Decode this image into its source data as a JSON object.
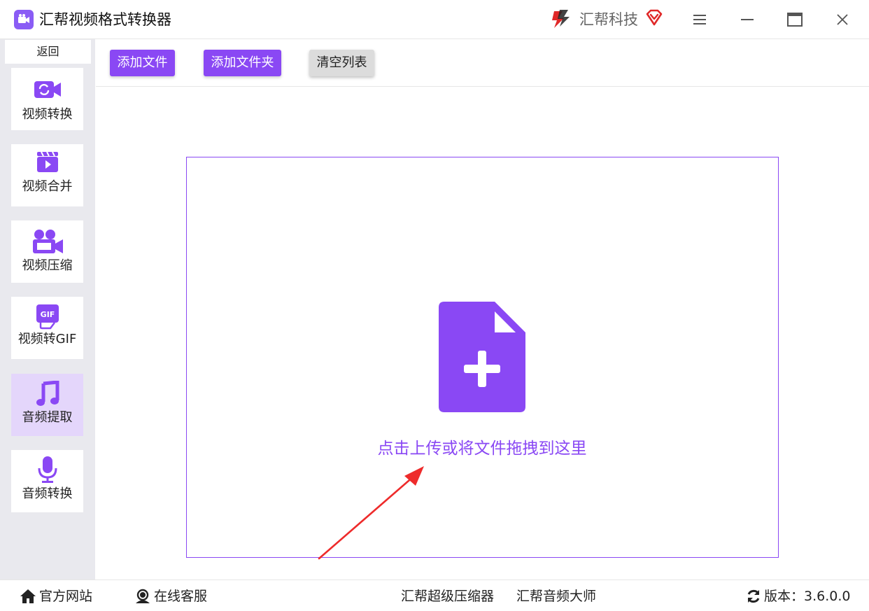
{
  "app": {
    "title": "汇帮视频格式转换器",
    "brand": "汇帮科技"
  },
  "sidebar": {
    "back_label": "返回",
    "items": [
      {
        "label": "视频转换",
        "icon": "video-convert-icon"
      },
      {
        "label": "视频合并",
        "icon": "video-merge-icon"
      },
      {
        "label": "视频压缩",
        "icon": "video-compress-icon"
      },
      {
        "label": "视频转GIF",
        "icon": "gif-icon"
      },
      {
        "label": "音频提取",
        "icon": "music-note-icon",
        "active": true
      },
      {
        "label": "音频转换",
        "icon": "microphone-icon"
      }
    ]
  },
  "toolbar": {
    "add_file": "添加文件",
    "add_folder": "添加文件夹",
    "clear_list": "清空列表"
  },
  "dropzone": {
    "text": "点击上传或将文件拖拽到这里"
  },
  "footer": {
    "website": "官方网站",
    "support": "在线客服",
    "compressor": "汇帮超级压缩器",
    "audio_master": "汇帮音频大师",
    "version_label": "版本：",
    "version": "3.6.0.0"
  },
  "colors": {
    "accent": "#8a48f4",
    "active_bg": "#e4d6fb",
    "arrow": "#ee2b2b"
  }
}
